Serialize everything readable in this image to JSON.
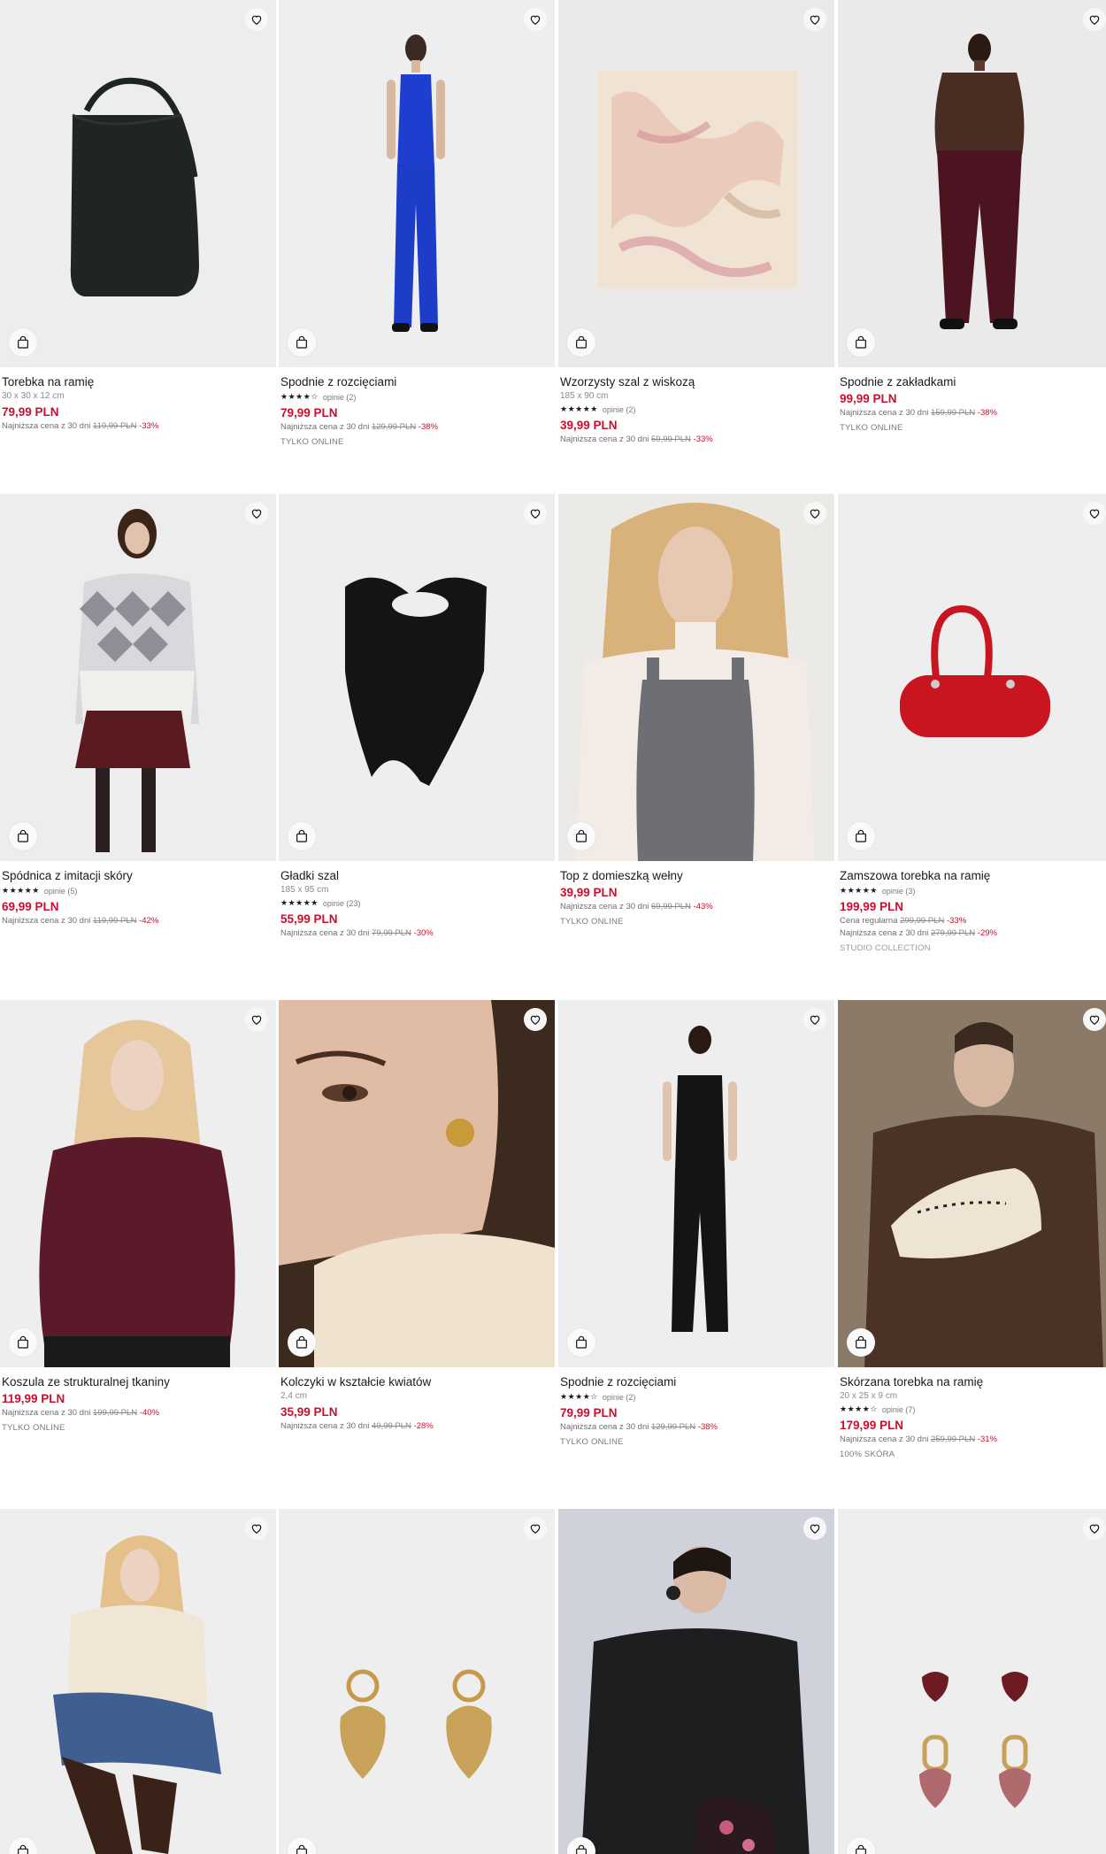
{
  "colors": {
    "sale": "#c8102e",
    "text": "#1a1a1a",
    "muted": "#8a8a8a"
  },
  "icons": {
    "favorite": "heart-icon",
    "add_to_cart": "shopping-bag-icon"
  },
  "products": [
    {
      "name": "Torebka na ramię",
      "dims": "30 x 30 x 12 cm",
      "rating_text": "",
      "price": "79,99 PLN",
      "lowest_label": "Najniższa cena z 30 dni",
      "old_price": "119,99 PLN",
      "discount": "-33%",
      "tag": ""
    },
    {
      "name": "Spodnie z rozcięciami",
      "dims": "",
      "rating_text": "opinie (2)",
      "stars": "★★★★☆",
      "price": "79,99 PLN",
      "lowest_label": "Najniższa cena z 30 dni",
      "old_price": "129,99 PLN",
      "discount": "-38%",
      "tag": "TYLKO ONLINE"
    },
    {
      "name": "Wzorzysty szal z wiskozą",
      "dims": "185 x 90 cm",
      "rating_text": "opinie (2)",
      "stars": "★★★★★",
      "price": "39,99 PLN",
      "lowest_label": "Najniższa cena z 30 dni",
      "old_price": "59,99 PLN",
      "discount": "-33%",
      "tag": ""
    },
    {
      "name": "Spodnie z zakładkami",
      "dims": "",
      "rating_text": "",
      "price": "99,99 PLN",
      "lowest_label": "Najniższa cena z 30 dni",
      "old_price": "159,99 PLN",
      "discount": "-38%",
      "tag": "TYLKO ONLINE"
    },
    {
      "name": "Spódnica z imitacji skóry",
      "dims": "",
      "rating_text": "opinie (5)",
      "stars": "★★★★★",
      "price": "69,99 PLN",
      "lowest_label": "Najniższa cena z 30 dni",
      "old_price": "119,99 PLN",
      "discount": "-42%",
      "tag": ""
    },
    {
      "name": "Gładki szal",
      "dims": "185 x 95 cm",
      "rating_text": "opinie (23)",
      "stars": "★★★★★",
      "price": "55,99 PLN",
      "lowest_label": "Najniższa cena z 30 dni",
      "old_price": "79,99 PLN",
      "discount": "-30%",
      "tag": ""
    },
    {
      "name": "Top z domieszką wełny",
      "dims": "",
      "rating_text": "",
      "price": "39,99 PLN",
      "lowest_label": "Najniższa cena z 30 dni",
      "old_price": "69,99 PLN",
      "discount": "-43%",
      "tag": "TYLKO ONLINE"
    },
    {
      "name": "Zamszowa torebka na ramię",
      "dims": "",
      "rating_text": "opinie (3)",
      "stars": "★★★★★",
      "price": "199,99 PLN",
      "regular_label": "Cena regularna",
      "regular_old": "299,99 PLN",
      "regular_disc": "-33%",
      "lowest_label": "Najniższa cena z 30 dni",
      "old_price": "279,99 PLN",
      "discount": "-29%",
      "tag": "STUDIO COLLECTION"
    },
    {
      "name": "Koszula ze strukturalnej tkaniny",
      "dims": "",
      "rating_text": "",
      "price": "119,99 PLN",
      "lowest_label": "Najniższa cena z 30 dni",
      "old_price": "199,99 PLN",
      "discount": "-40%",
      "tag": "TYLKO ONLINE"
    },
    {
      "name": "Kolczyki w kształcie kwiatów",
      "dims": "2,4 cm",
      "rating_text": "",
      "price": "35,99 PLN",
      "lowest_label": "Najniższa cena z 30 dni",
      "old_price": "49,99 PLN",
      "discount": "-28%",
      "tag": ""
    },
    {
      "name": "Spodnie z rozcięciami",
      "dims": "",
      "rating_text": "opinie (2)",
      "stars": "★★★★☆",
      "price": "79,99 PLN",
      "lowest_label": "Najniższa cena z 30 dni",
      "old_price": "129,99 PLN",
      "discount": "-38%",
      "tag": "TYLKO ONLINE"
    },
    {
      "name": "Skórzana torebka na ramię",
      "dims": "20 x 25 x 9 cm",
      "rating_text": "opinie (7)",
      "stars": "★★★★☆",
      "price": "179,99 PLN",
      "lowest_label": "Najniższa cena z 30 dni",
      "old_price": "259,99 PLN",
      "discount": "-31%",
      "tag": "100% SKÓRA"
    },
    {
      "name": "",
      "dims": "",
      "rating_text": "",
      "price": "",
      "lowest_label": "",
      "old_price": "",
      "discount": "",
      "tag": ""
    },
    {
      "name": "",
      "dims": "",
      "rating_text": "",
      "price": "",
      "lowest_label": "",
      "old_price": "",
      "discount": "",
      "tag": ""
    },
    {
      "name": "",
      "dims": "",
      "rating_text": "",
      "price": "",
      "lowest_label": "",
      "old_price": "",
      "discount": "",
      "tag": ""
    },
    {
      "name": "",
      "dims": "",
      "rating_text": "",
      "price": "",
      "lowest_label": "",
      "old_price": "",
      "discount": "",
      "tag": ""
    }
  ]
}
